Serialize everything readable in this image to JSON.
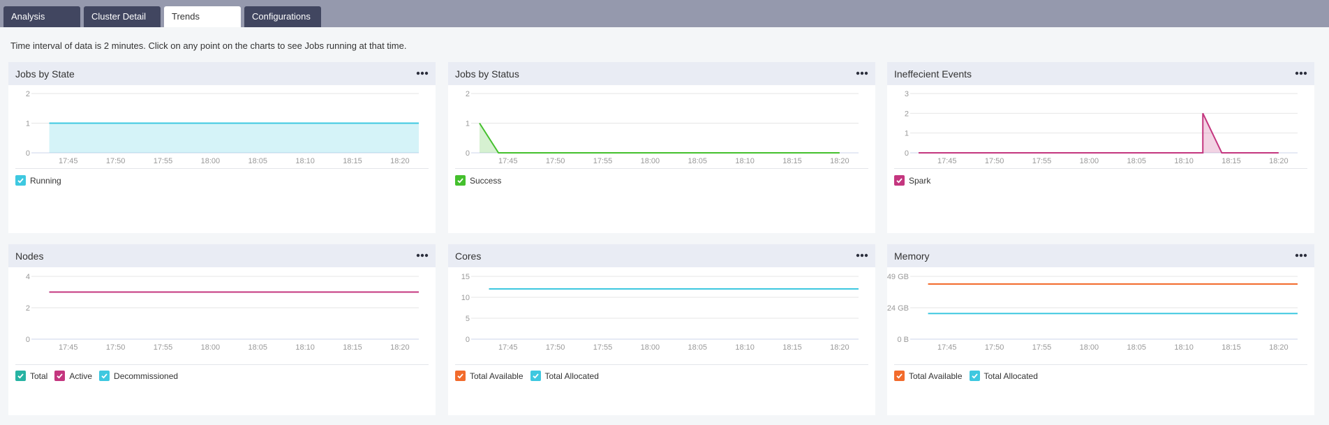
{
  "tabs": [
    {
      "label": "Analysis",
      "active": false
    },
    {
      "label": "Cluster Detail",
      "active": false
    },
    {
      "label": "Trends",
      "active": true
    },
    {
      "label": "Configurations",
      "active": false
    }
  ],
  "info_text": "Time interval of data is 2 minutes. Click on any point on the charts to see Jobs running at that time.",
  "menu_icon": "more-horizontal-icon",
  "checkbox_icon": "checkmark-icon",
  "x_ticks": [
    "17:45",
    "17:50",
    "17:55",
    "18:00",
    "18:05",
    "18:10",
    "18:15",
    "18:20"
  ],
  "chart_data": [
    {
      "type": "area",
      "title": "Jobs by State",
      "x_ticks": [
        "17:45",
        "17:50",
        "17:55",
        "18:00",
        "18:05",
        "18:10",
        "18:15",
        "18:20"
      ],
      "ylim": [
        0,
        2
      ],
      "y_ticks": [
        "0",
        "1",
        "2"
      ],
      "grid": true,
      "series": [
        {
          "name": "Running",
          "color": "#3ec8e0",
          "fill": true,
          "points": [
            [
              "17:43",
              1
            ],
            [
              "18:22",
              1
            ]
          ]
        }
      ],
      "legend": "bottom-left"
    },
    {
      "type": "area",
      "title": "Jobs by Status",
      "x_ticks": [
        "17:45",
        "17:50",
        "17:55",
        "18:00",
        "18:05",
        "18:10",
        "18:15",
        "18:20"
      ],
      "ylim": [
        0,
        2
      ],
      "y_ticks": [
        "0",
        "1",
        "2"
      ],
      "grid": true,
      "series": [
        {
          "name": "Success",
          "color": "#44c02d",
          "fill": true,
          "points": [
            [
              "17:42",
              1
            ],
            [
              "17:44",
              0
            ],
            [
              "18:20",
              0
            ]
          ]
        }
      ],
      "legend": "bottom-left"
    },
    {
      "type": "area",
      "title": "Ineffecient Events",
      "x_ticks": [
        "17:45",
        "17:50",
        "17:55",
        "18:00",
        "18:05",
        "18:10",
        "18:15",
        "18:20"
      ],
      "ylim": [
        0,
        3
      ],
      "y_ticks": [
        "0",
        "1",
        "2",
        "3"
      ],
      "grid": true,
      "series": [
        {
          "name": "Spark",
          "color": "#c4367f",
          "fill": true,
          "points": [
            [
              "17:42",
              0
            ],
            [
              "18:12",
              0
            ],
            [
              "18:12",
              2
            ],
            [
              "18:14",
              0
            ],
            [
              "18:20",
              0
            ]
          ]
        }
      ],
      "legend": "bottom-left"
    },
    {
      "type": "line",
      "title": "Nodes",
      "x_ticks": [
        "17:45",
        "17:50",
        "17:55",
        "18:00",
        "18:05",
        "18:10",
        "18:15",
        "18:20"
      ],
      "ylim": [
        0,
        4
      ],
      "y_ticks": [
        "0",
        "2",
        "4"
      ],
      "grid": true,
      "series": [
        {
          "name": "Total",
          "color": "#27b3a3",
          "points": [
            [
              "17:43",
              3
            ],
            [
              "18:22",
              3
            ]
          ]
        },
        {
          "name": "Active",
          "color": "#c4367f",
          "points": [
            [
              "17:43",
              3
            ],
            [
              "18:22",
              3
            ]
          ]
        },
        {
          "name": "Decommissioned",
          "color": "#3ec8e0",
          "points": []
        }
      ],
      "legend": "bottom-left"
    },
    {
      "type": "line",
      "title": "Cores",
      "x_ticks": [
        "17:45",
        "17:50",
        "17:55",
        "18:00",
        "18:05",
        "18:10",
        "18:15",
        "18:20"
      ],
      "ylim": [
        0,
        15
      ],
      "y_ticks": [
        "0",
        "5",
        "10",
        "15"
      ],
      "grid": true,
      "series": [
        {
          "name": "Total Available",
          "color": "#f26b2c",
          "points": [
            [
              "17:43",
              12
            ],
            [
              "18:22",
              12
            ]
          ]
        },
        {
          "name": "Total Allocated",
          "color": "#3ec8e0",
          "points": [
            [
              "17:43",
              12
            ],
            [
              "18:22",
              12
            ]
          ]
        }
      ],
      "legend": "bottom-left"
    },
    {
      "type": "line",
      "title": "Memory",
      "x_ticks": [
        "17:45",
        "17:50",
        "17:55",
        "18:00",
        "18:05",
        "18:10",
        "18:15",
        "18:20"
      ],
      "ylim": [
        0,
        49
      ],
      "y_ticks": [
        "0 B",
        "24 GB",
        "49 GB"
      ],
      "grid": true,
      "series": [
        {
          "name": "Total Available",
          "color": "#f26b2c",
          "points": [
            [
              "17:43",
              43
            ],
            [
              "18:22",
              43
            ]
          ]
        },
        {
          "name": "Total Allocated",
          "color": "#3ec8e0",
          "points": [
            [
              "17:43",
              20
            ],
            [
              "18:22",
              20
            ]
          ]
        }
      ],
      "legend": "bottom-left"
    }
  ]
}
